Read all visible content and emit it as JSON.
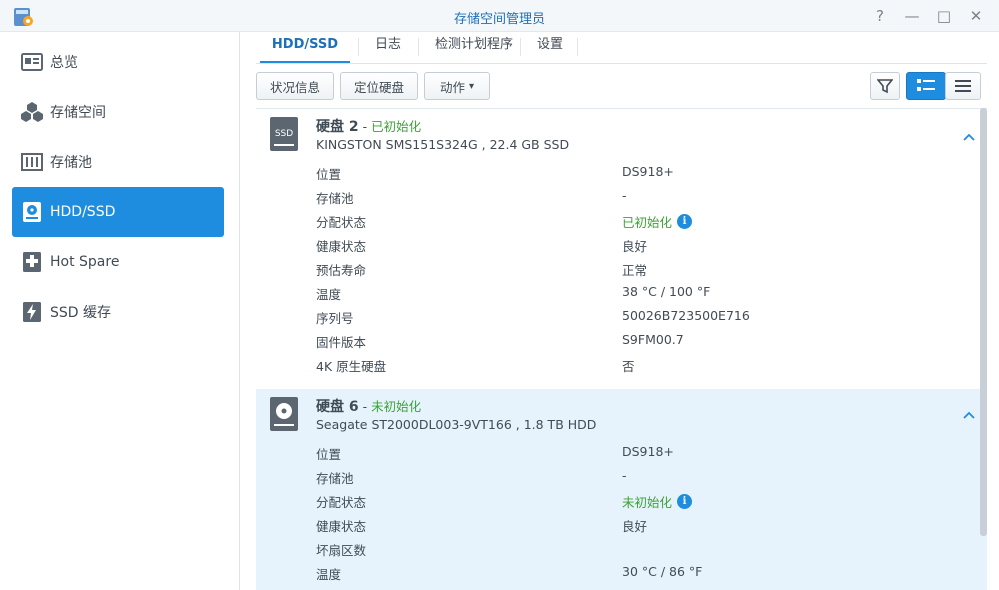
{
  "window": {
    "title": "存储空间管理员",
    "controls": [
      "?",
      "—",
      "□",
      "✕"
    ]
  },
  "sidebar": {
    "items": [
      {
        "label": "总览",
        "icon": "overview-icon"
      },
      {
        "label": "存储空间",
        "icon": "volume-cubes-icon"
      },
      {
        "label": "存储池",
        "icon": "storage-pool-icon"
      },
      {
        "label": "HDD/SSD",
        "icon": "disk-icon",
        "active": true
      },
      {
        "label": "Hot Spare",
        "icon": "hot-spare-icon"
      },
      {
        "label": "SSD 缓存",
        "icon": "ssd-cache-icon"
      }
    ]
  },
  "tabs": [
    {
      "label": "HDD/SSD",
      "active": true
    },
    {
      "label": "日志"
    },
    {
      "label": "检测计划程序"
    },
    {
      "label": "设置"
    }
  ],
  "toolbar": {
    "status_label": "状况信息",
    "locate_label": "定位硬盘",
    "action_label": "动作",
    "action_caret": "▾"
  },
  "colors": {
    "accent": "#1e8de0",
    "status_green": "#3aa332",
    "selected_row": "#e6f3fd"
  },
  "disks": [
    {
      "name": "硬盘 2",
      "separator": " - ",
      "status": "已初始化",
      "model": "KINGSTON SMS151S324G , 22.4 GB SSD",
      "icon": "ssd-icon",
      "icon_text": "SSD",
      "rows": [
        {
          "label": "位置",
          "value": "DS918+"
        },
        {
          "label": "存储池",
          "value": "-"
        },
        {
          "label": "分配状态",
          "value": "已初始化",
          "green": true,
          "info": true
        },
        {
          "label": "健康状态",
          "value": "良好",
          "green": true
        },
        {
          "label": "预估寿命",
          "value": "正常",
          "green": true
        },
        {
          "label": "温度",
          "value": "38 °C / 100 °F"
        },
        {
          "label": "序列号",
          "value": "50026B723500E716"
        },
        {
          "label": "固件版本",
          "value": "S9FM00.7"
        },
        {
          "label": "4K 原生硬盘",
          "value": "否"
        }
      ]
    },
    {
      "name": "硬盘 6",
      "separator": " - ",
      "status": "未初始化",
      "model": "Seagate ST2000DL003-9VT166 , 1.8 TB HDD",
      "icon": "hdd-icon",
      "rows": [
        {
          "label": "位置",
          "value": "DS918+"
        },
        {
          "label": "存储池",
          "value": "-"
        },
        {
          "label": "分配状态",
          "value": "未初始化",
          "green": true,
          "info": true
        },
        {
          "label": "健康状态",
          "value": "良好",
          "green": true
        },
        {
          "label": "坏扇区数",
          "value": ""
        },
        {
          "label": "温度",
          "value": "30 °C / 86 °F"
        }
      ]
    }
  ],
  "info_glyph": "i"
}
